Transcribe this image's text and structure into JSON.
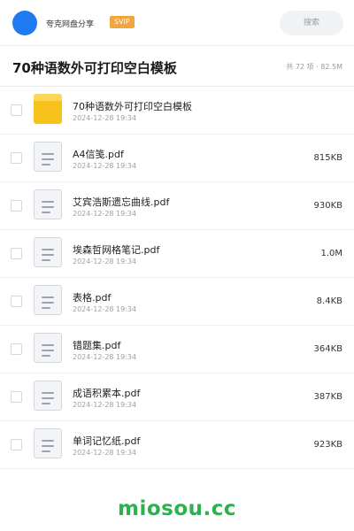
{
  "topbar": {
    "brand": "夸克网盘分享",
    "badge": "SVIP",
    "search_label": "搜索"
  },
  "header": {
    "title": "70种语数外可打印空白模板",
    "meta": "共 72 项 · 82.5M"
  },
  "files": [
    {
      "name": "70种语数外可打印空白模板",
      "date": "2024-12-28 19:34",
      "size": "",
      "type": "folder"
    },
    {
      "name": "A4信笺.pdf",
      "date": "2024-12-28 19:34",
      "size": "815KB",
      "type": "pdf"
    },
    {
      "name": "艾宾浩斯遗忘曲线.pdf",
      "date": "2024-12-28 19:34",
      "size": "930KB",
      "type": "pdf"
    },
    {
      "name": "埃森哲网格笔记.pdf",
      "date": "2024-12-28 19:34",
      "size": "1.0M",
      "type": "pdf"
    },
    {
      "name": "表格.pdf",
      "date": "2024-12-28 19:34",
      "size": "8.4KB",
      "type": "pdf"
    },
    {
      "name": "错题集.pdf",
      "date": "2024-12-28 19:34",
      "size": "364KB",
      "type": "pdf"
    },
    {
      "name": "成语积累本.pdf",
      "date": "2024-12-28 19:34",
      "size": "387KB",
      "type": "pdf"
    },
    {
      "name": "单词记忆纸.pdf",
      "date": "2024-12-28 19:34",
      "size": "923KB",
      "type": "pdf"
    }
  ],
  "watermark": "miosou.cc",
  "colors": {
    "avatar": "#1e7bf0",
    "badge": "#f3a43a",
    "folder": "#f7c21b",
    "watermark": "#2bb24c"
  }
}
